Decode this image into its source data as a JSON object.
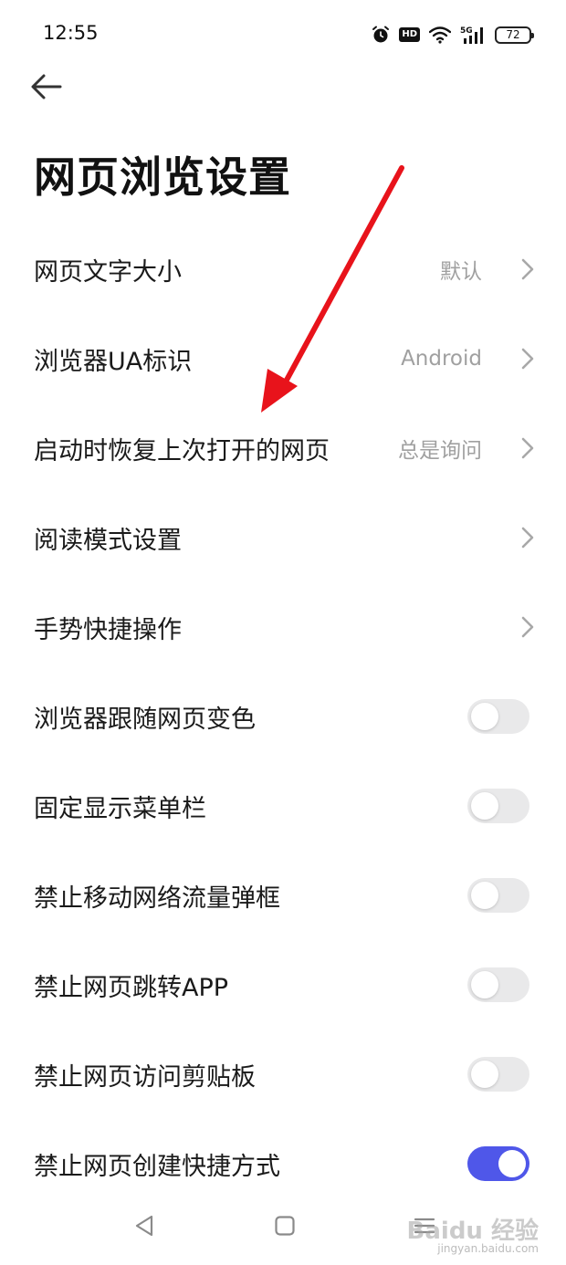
{
  "status_bar": {
    "time": "12:55",
    "network": "5G",
    "battery": "72",
    "hd": "HD"
  },
  "header": {
    "title": "网页浏览设置"
  },
  "settings": [
    {
      "label": "网页文字大小",
      "value": "默认"
    },
    {
      "label": "浏览器UA标识",
      "value": "Android"
    },
    {
      "label": "启动时恢复上次打开的网页",
      "value": "总是询问"
    },
    {
      "label": "阅读模式设置",
      "value": ""
    },
    {
      "label": "手势快捷操作",
      "value": ""
    },
    {
      "label": "浏览器跟随网页变色",
      "enabled": false
    },
    {
      "label": "固定显示菜单栏",
      "enabled": false
    },
    {
      "label": "禁止移动网络流量弹框",
      "enabled": false
    },
    {
      "label": "禁止网页跳转APP",
      "enabled": false
    },
    {
      "label": "禁止网页访问剪贴板",
      "enabled": false
    },
    {
      "label": "禁止网页创建快捷方式",
      "enabled": true
    }
  ],
  "watermark": {
    "main": "Baidu 经验",
    "sub": "jingyan.baidu.com"
  },
  "colors": {
    "toggle_on": "#4f57e9",
    "toggle_off": "#e9e9ea",
    "annotation_arrow": "#e8131b"
  },
  "icons": {
    "back": "arrow-left-icon",
    "chevron": "chevron-right-icon",
    "nav_back": "triangle-back-icon",
    "nav_home": "square-home-icon",
    "nav_recents": "menu-lines-icon"
  }
}
